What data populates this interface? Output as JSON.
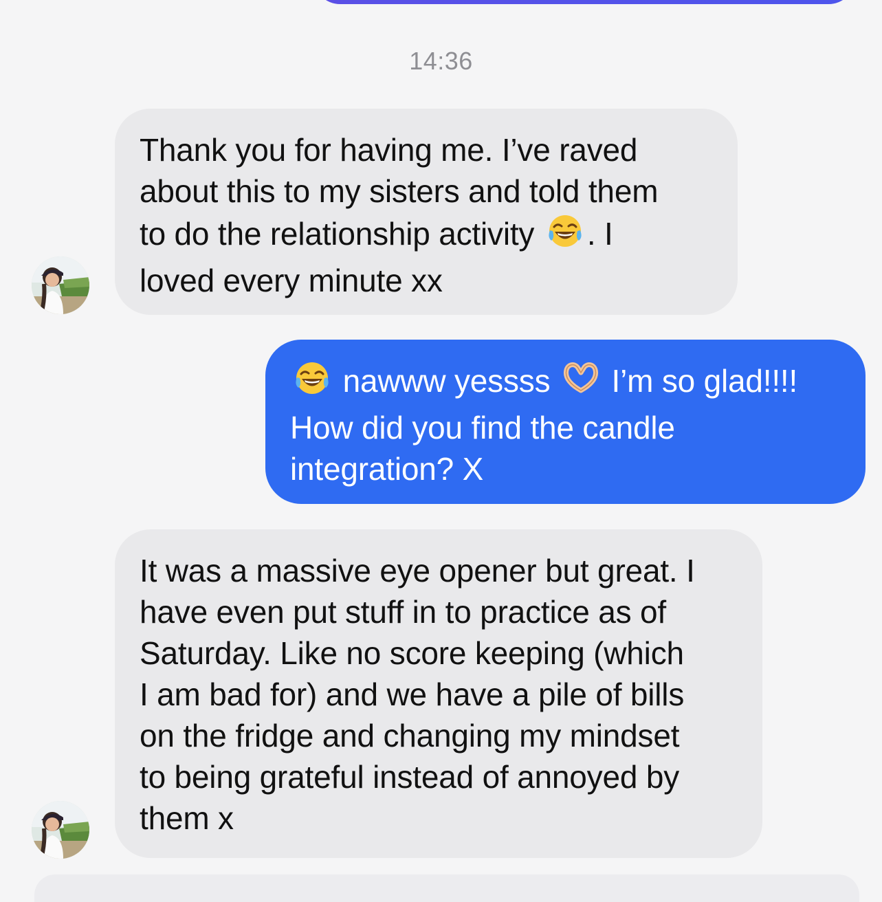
{
  "conversation": {
    "timestamp": "14:36",
    "messages": [
      {
        "direction": "incoming",
        "lines": [
          "Thank you for having me. I’ve raved",
          "about this to my sisters and told them",
          "to do the relationship activity ",
          ". I",
          "loved every minute xx"
        ]
      },
      {
        "direction": "outgoing",
        "lines": [
          " nawww yessss ",
          " I’m so glad!!!!",
          "How did you find the candle",
          "integration? X"
        ]
      },
      {
        "direction": "incoming",
        "lines": [
          "It was a massive eye opener but great. I",
          "have even put stuff in to practice as of",
          "Saturday. Like no score keeping (which",
          "I am bad for) and we have a pile of bills",
          "on the fridge and changing my mindset",
          "to being grateful instead of annoyed by",
          "them x"
        ]
      }
    ]
  },
  "icons": {
    "laughing": "face-with-tears-of-joy-icon",
    "heart_hands": "heart-hands-icon",
    "avatar": "contact-avatar"
  },
  "colors": {
    "background": "#f5f5f6",
    "incoming_bubble": "#e9e9eb",
    "outgoing_bubble": "#2f6bf2",
    "timestamp": "#8e8e93"
  }
}
